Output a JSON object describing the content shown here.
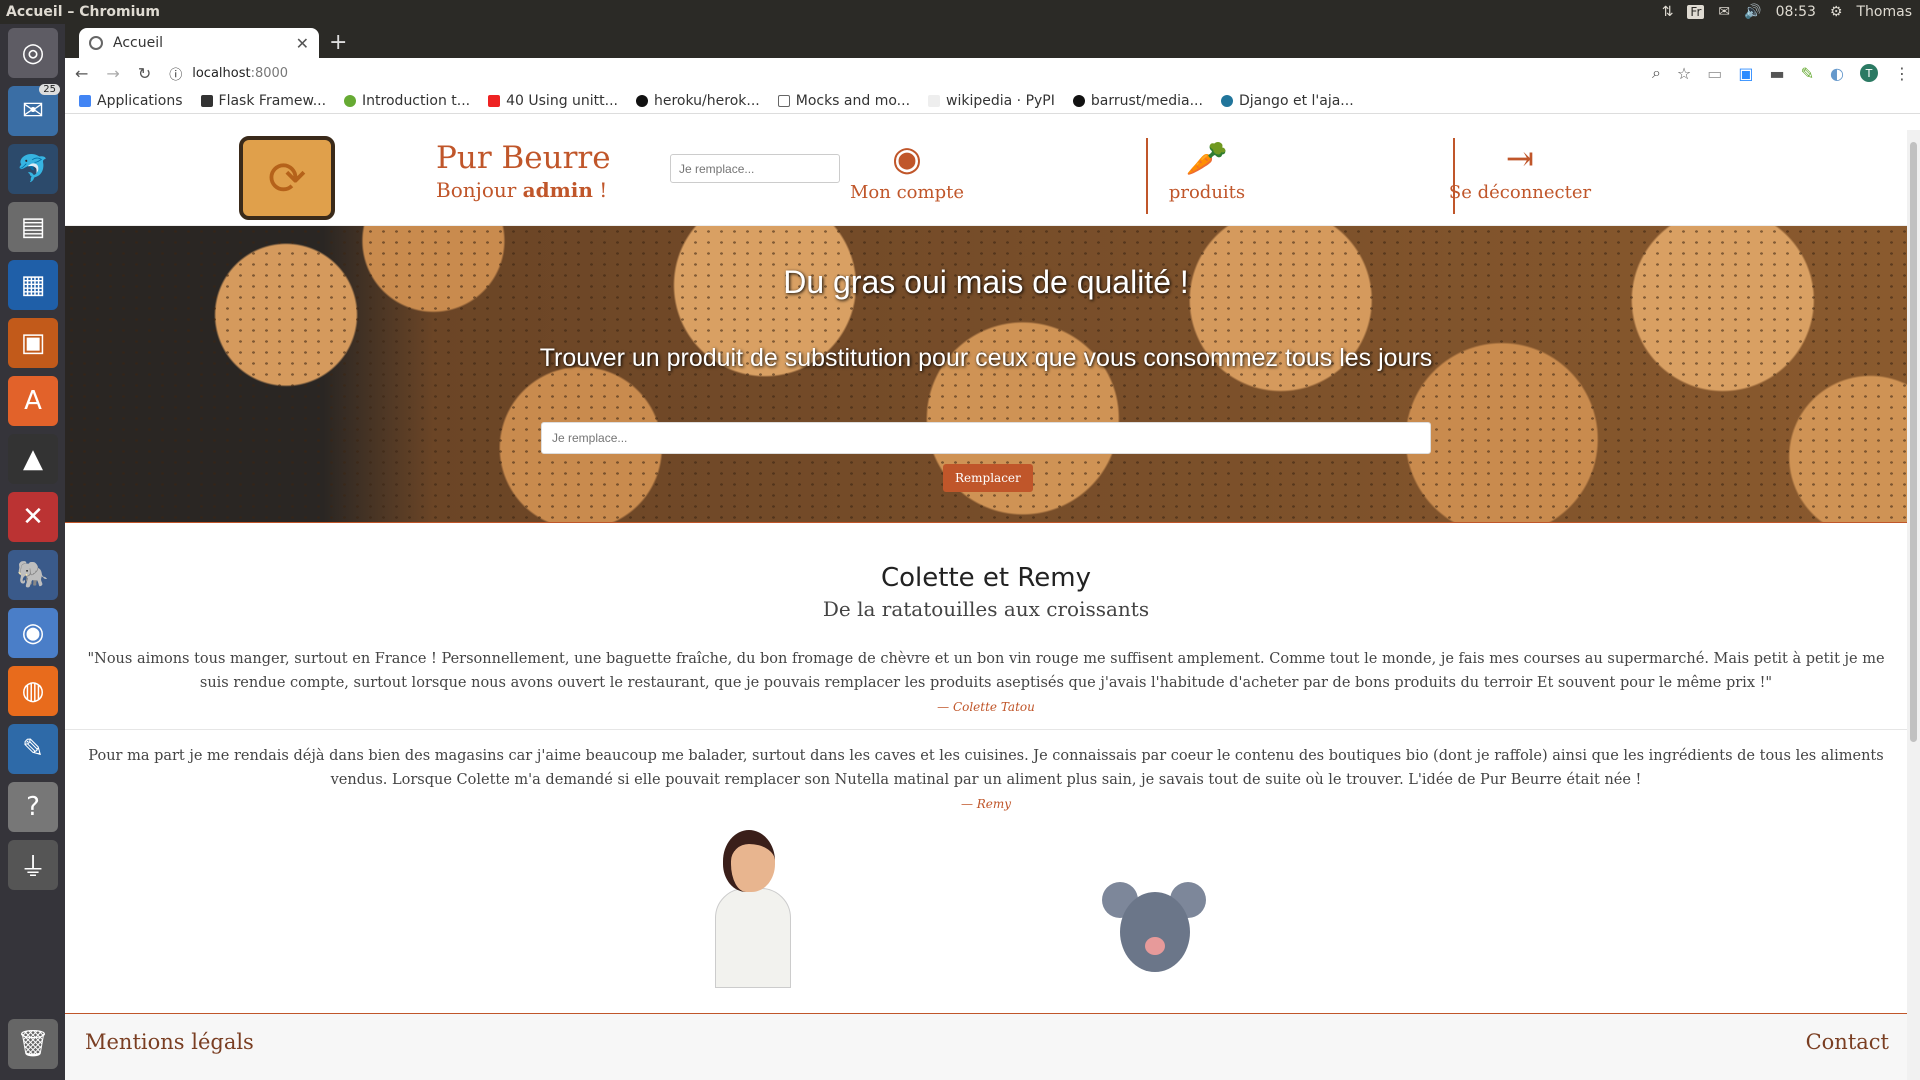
{
  "os": {
    "window_title": "Accueil – Chromium",
    "keyboard_layout": "Fr",
    "clock": "08:53",
    "user": "Thomas",
    "mail_badge": "25"
  },
  "browser": {
    "tab_title": "Accueil",
    "url_host": "localhost",
    "url_port": ":8000",
    "avatar_letter": "T",
    "bookmarks": [
      {
        "label": "Applications",
        "icon": "apps-grid-icon"
      },
      {
        "label": "Flask Framew...",
        "icon": "flask-icon"
      },
      {
        "label": "Introduction t...",
        "icon": "leaf-icon"
      },
      {
        "label": "40 Using unitt...",
        "icon": "youtube-icon"
      },
      {
        "label": "heroku/herok...",
        "icon": "github-icon"
      },
      {
        "label": "Mocks and mo...",
        "icon": "document-icon"
      },
      {
        "label": "wikipedia · PyPI",
        "icon": "pypi-icon"
      },
      {
        "label": "barrust/media...",
        "icon": "github-icon"
      },
      {
        "label": "Django et l'aja...",
        "icon": "wordpress-icon"
      }
    ]
  },
  "site": {
    "brand_name": "Pur Beurre",
    "greeting": "Bonjour",
    "username": "admin",
    "greeting_suffix": " !",
    "header_search_placeholder": "Je remplace...",
    "nav": [
      {
        "label": "Mon compte",
        "icon": "user-circle-icon"
      },
      {
        "label": "produits",
        "icon": "carrot-icon"
      },
      {
        "label": "Se déconnecter",
        "icon": "sign-out-icon"
      }
    ],
    "hero": {
      "title": "Du gras oui mais de qualité !",
      "subtitle": "Trouver un produit de substitution pour ceux que vous consommez tous les jours",
      "search_placeholder": "Je remplace...",
      "button": "Remplacer"
    },
    "about": {
      "title": "Colette et Remy",
      "subtitle": "De la ratatouilles aux croissants",
      "quote1": "\"Nous aimons tous manger, surtout en France ! Personnellement, une baguette fraîche, du bon fromage de chèvre et un bon vin rouge me suffisent amplement. Comme tout le monde, je fais mes courses au supermarché. Mais petit à petit je me suis rendue compte, surtout lorsque nous avons ouvert le restaurant, que je pouvais remplacer les produits aseptisés que j'avais l'habitude d'acheter par de bons produits du terroir Et souvent pour le même prix !\"",
      "cite1": "— Colette Tatou",
      "quote2": "Pour ma part je me rendais déjà dans bien des magasins car j'aime beaucoup me balader, surtout dans les caves et les cuisines. Je connaissais par coeur le contenu des boutiques bio (dont je raffole) ainsi que les ingrédients de tous les aliments vendus. Lorsque Colette m'a demandé si elle pouvait remplacer son Nutella matinal par un aliment plus sain, je savais tout de suite où le trouver. L'idée de Pur Beurre était née !",
      "cite2": "— Remy"
    },
    "footer": {
      "legal": "Mentions légals",
      "contact": "Contact"
    }
  },
  "colors": {
    "brand": "#c0562a",
    "footer_text": "#7a3e22"
  }
}
